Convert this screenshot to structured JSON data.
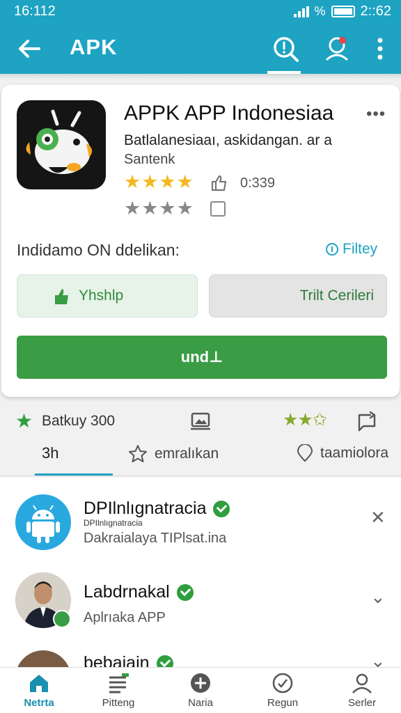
{
  "status": {
    "time": "16:112",
    "clock_right": "2::62"
  },
  "appbar": {
    "title": "APK"
  },
  "app": {
    "name": "APPK APP Indonesiaa",
    "desc_line1": "Batlalanesiaaı, askidangan. ar a",
    "desc_line2": "Santenk",
    "stars_filled": "★★★★",
    "stars_empty": "★★★★",
    "rating_count": "0:339",
    "more": "•••",
    "section_label": "Indidamo ON ddelikan:",
    "filter_label": "Filtey",
    "button_left": "Yhshlp",
    "button_right": "Trilt Cerileri",
    "button_main": "und⊥"
  },
  "info": {
    "text": "Batkuy 300",
    "stars": "★★✩"
  },
  "tabs": [
    {
      "label": "3h"
    },
    {
      "label": "emralıkan"
    },
    {
      "label": "taamiolora"
    }
  ],
  "list": [
    {
      "name": "DPIlnlıgnatracia",
      "sub_top": "DPIlnlıgnatracia",
      "sub": "Dakraialaya TIPlsat.ina",
      "action": "✕"
    },
    {
      "name": "Labdrnakal",
      "sub": "Aplrıaka APP",
      "action": "⌄"
    },
    {
      "name": "bebaiain",
      "action": "⌄"
    }
  ],
  "bottom_nav": [
    {
      "label": "Netrta",
      "icon": "home-icon"
    },
    {
      "label": "Pitteng",
      "icon": "list-icon"
    },
    {
      "label": "Naria",
      "icon": "add-circle-icon"
    },
    {
      "label": "Regun",
      "icon": "check-circle-icon"
    },
    {
      "label": "Serler",
      "icon": "person-icon"
    }
  ],
  "colors": {
    "accent": "#1ea3c2",
    "green": "#3a9c44",
    "star": "#f5b820"
  }
}
